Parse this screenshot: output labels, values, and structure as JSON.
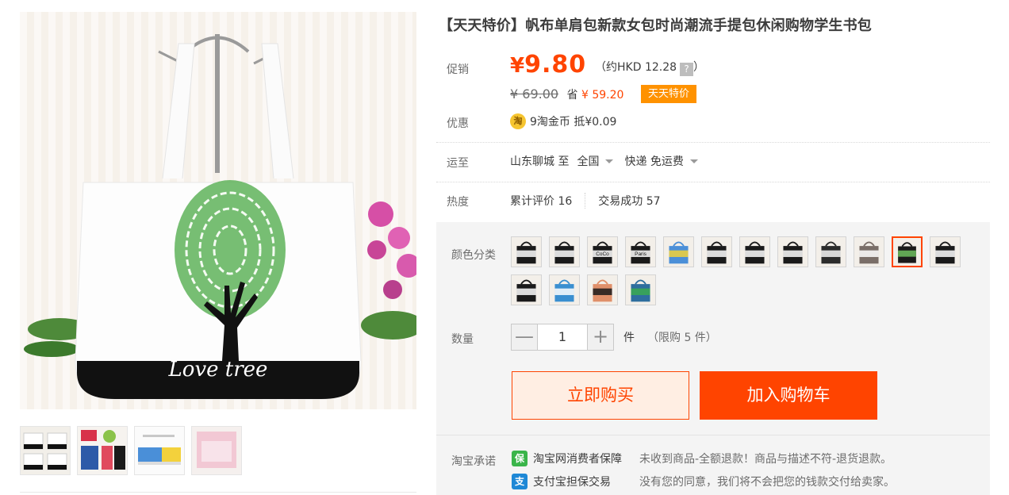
{
  "product": {
    "title": "【天天特价】帆布单肩包新款女包时尚潮流手提包休闲购物学生书包",
    "main_image_text": "Love tree"
  },
  "price": {
    "promo_label": "促销",
    "currency": "¥",
    "current": "9.80",
    "hkd_text": "（约HKD 12.28",
    "hkd_close": "）",
    "help_icon": "?",
    "original": "¥ 69.00",
    "save_label": "省",
    "save_amount": "¥ 59.20",
    "badge": "天天特价"
  },
  "discount": {
    "label": "优惠",
    "icon_text": "淘",
    "text": "9淘金币 抵¥0.09"
  },
  "shipping": {
    "label": "运至",
    "origin": "山东聊城 至",
    "destination": "全国",
    "method": "快递 免运费"
  },
  "popularity": {
    "label": "热度",
    "reviews_label": "累计评价",
    "reviews_count": "16",
    "sales_label": "交易成功",
    "sales_count": "57"
  },
  "color": {
    "label": "颜色分类",
    "options": [
      {
        "text": "",
        "colors": [
          "#1a1a1a",
          "#ffffff"
        ]
      },
      {
        "text": "",
        "colors": [
          "#1a1a1a",
          "#ffffff"
        ]
      },
      {
        "text": "CoCo",
        "colors": [
          "#1a1a1a",
          "#ffffff"
        ]
      },
      {
        "text": "Paris",
        "colors": [
          "#1a1a1a",
          "#ffffff"
        ]
      },
      {
        "text": "",
        "colors": [
          "#4b8fd8",
          "#f2d23a"
        ]
      },
      {
        "text": "",
        "colors": [
          "#1a1a1a",
          "#ffffff"
        ]
      },
      {
        "text": "",
        "colors": [
          "#1a1a1a",
          "#ffffff"
        ]
      },
      {
        "text": "",
        "colors": [
          "#1a1a1a",
          "#ffffff"
        ]
      },
      {
        "text": "",
        "colors": [
          "#2b2b2b",
          "#f5f5f5"
        ]
      },
      {
        "text": "",
        "colors": [
          "#7a6e68",
          "#ffffff"
        ]
      },
      {
        "text": "",
        "colors": [
          "#1a1a1a",
          "#6fbf5f"
        ]
      },
      {
        "text": "",
        "colors": [
          "#1a1a1a",
          "#ffffff"
        ]
      },
      {
        "text": "",
        "colors": [
          "#1a1a1a",
          "#ffffff"
        ]
      },
      {
        "text": "",
        "colors": [
          "#3a8fd0",
          "#ffffff"
        ]
      },
      {
        "text": "",
        "colors": [
          "#e0906a",
          "#1a1a1a"
        ]
      },
      {
        "text": "",
        "colors": [
          "#2e6e9e",
          "#3aaa50"
        ]
      }
    ],
    "selected_index": 10
  },
  "quantity": {
    "label": "数量",
    "minus": "—",
    "value": "1",
    "plus": "+",
    "unit": "件",
    "limit": "（限购 5 件）"
  },
  "actions": {
    "buy_now": "立即购买",
    "add_to_cart": "加入购物车"
  },
  "promise": {
    "label": "淘宝承诺",
    "items": [
      {
        "icon": "保",
        "name": "淘宝网消费者保障",
        "desc": "未收到商品-全额退款！商品与描述不符-退货退款。",
        "color": "#3ab54a"
      },
      {
        "icon": "支",
        "name": "支付宝担保交易",
        "desc": "没有您的同意，我们将不会把您的钱款交付给卖家。",
        "color": "#1e88d6"
      }
    ]
  },
  "colors": {
    "accent": "#ff4400",
    "badge": "#ff9200",
    "panel_bg": "#f4f4f4"
  }
}
